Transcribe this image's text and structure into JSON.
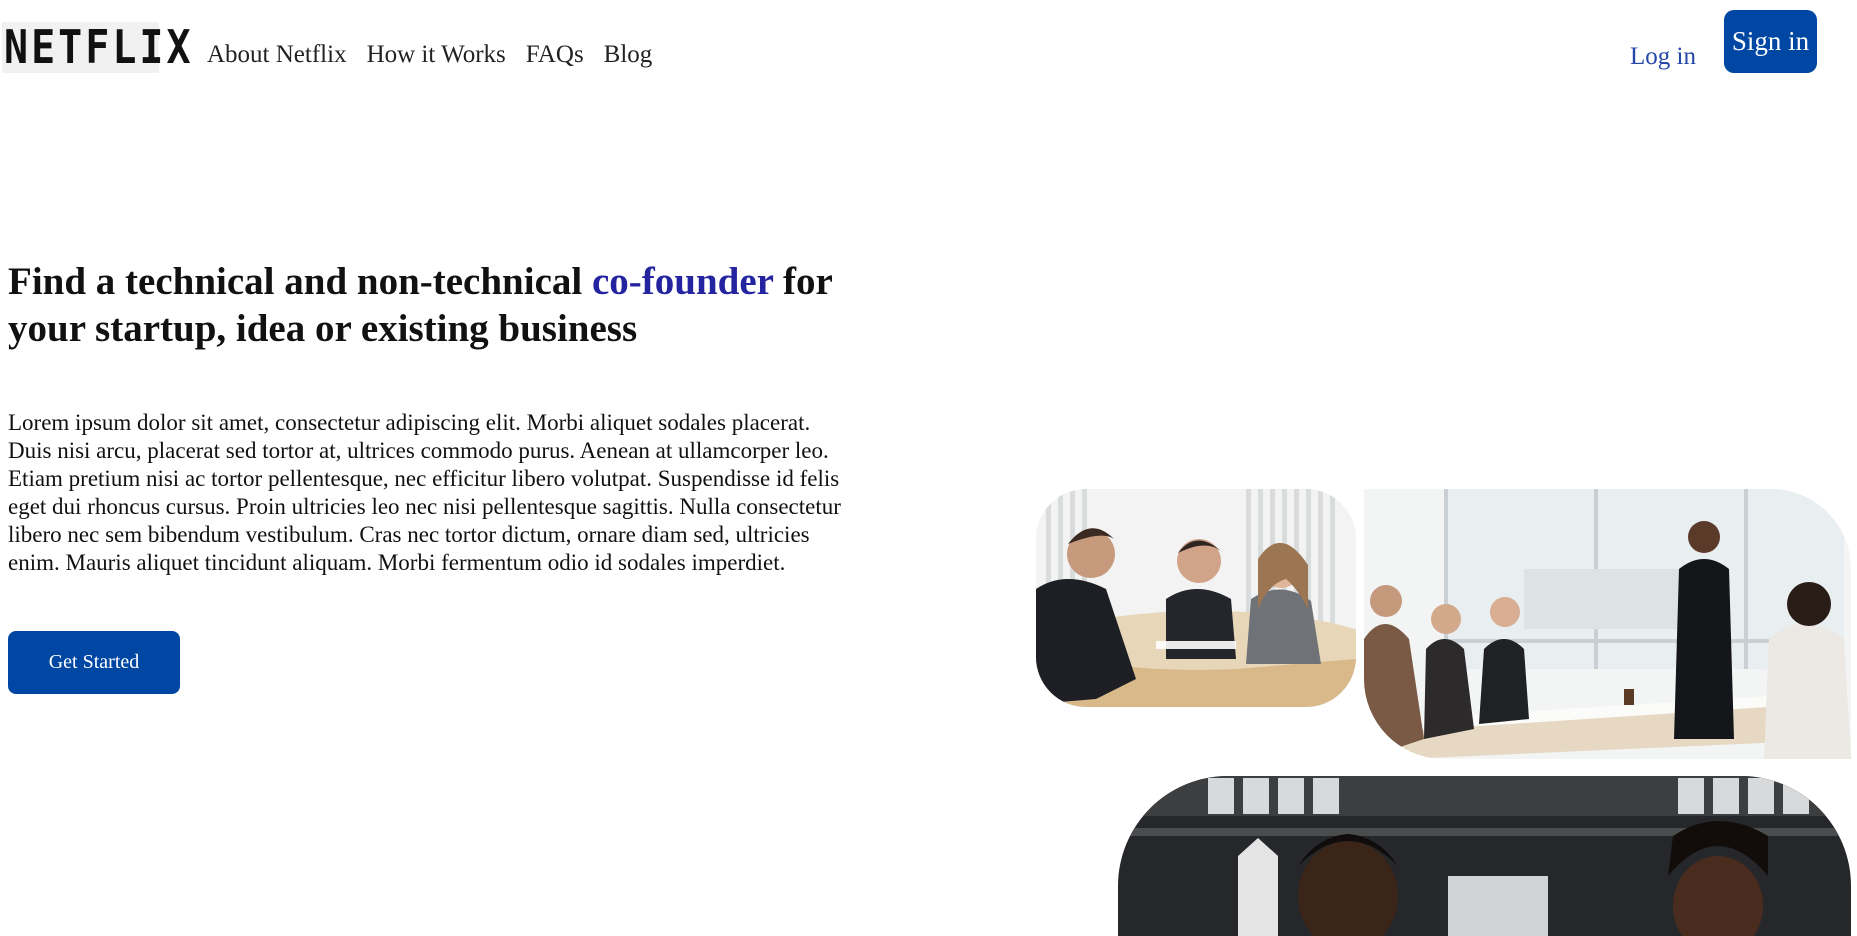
{
  "brand": {
    "logo_text": "NETFLIX"
  },
  "nav": {
    "items": [
      "About Netflix",
      "How it Works",
      "FAQs",
      "Blog"
    ],
    "login_label": "Log in",
    "signin_label": "Sign in"
  },
  "hero": {
    "headline_part1": "Find a technical and non-technical ",
    "headline_accent": "co-founder",
    "headline_part2": " for your startup, idea or existing business",
    "body": "Lorem ipsum dolor sit amet, consectetur adipiscing elit. Morbi aliquet sodales placerat. Duis nisi arcu, placerat sed tortor at, ultrices commodo purus. Aenean at ullamcorper leo. Etiam pretium nisi ac tortor pellentesque, nec efficitur libero volutpat. Suspendisse id felis eget dui rhoncus cursus. Proin ultricies leo nec nisi pellentesque sagittis. Nulla consectetur libero nec sem bibendum vestibulum. Cras nec tortor dictum, ornare diam sed, ultricies enim. Mauris aliquet tincidunt aliquam. Morbi fermentum odio id sodales imperdiet.",
    "cta_label": "Get Started"
  },
  "colors": {
    "primary": "#0047a3",
    "accent_text": "#2424a0",
    "link": "#2446a8"
  }
}
